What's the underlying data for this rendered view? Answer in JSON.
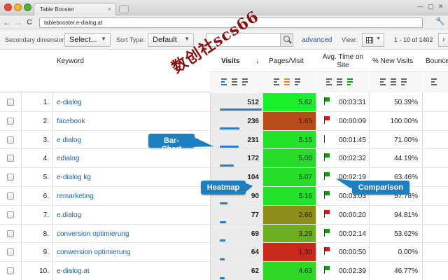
{
  "browser": {
    "tab_title": "Table Booster",
    "tab_close": "×",
    "url": "tablebooster.e-dialog.at",
    "back": "←",
    "forward": "→",
    "reload": "C",
    "wrench": "🔧"
  },
  "controls": {
    "secondary_dimension_label": "Secondary dimension:",
    "secondary_dimension_value": "Select...",
    "sort_type_label": "Sort Type:",
    "sort_type_value": "Default",
    "search_placeholder": "",
    "advanced_label": "advanced",
    "view_label": "View:",
    "pagination": "1 - 10 of 1402",
    "next": "›"
  },
  "table": {
    "headers": {
      "keyword": "Keyword",
      "visits": "Visits",
      "pages_visit": "Pages/Visit",
      "avg_time_line1": "Avg. Time on",
      "avg_time_line2": "Site",
      "new_visits": "% New Visits",
      "bounce": "Bounce"
    },
    "sort_arrow": "↓",
    "rows": [
      {
        "n": "1.",
        "keyword": "e-dialog",
        "visits": "512",
        "pages": "5.62",
        "time": "00:03:31",
        "new": "50.39%",
        "heat": "#17f02a",
        "flag": "#139a13",
        "bar": 1.0
      },
      {
        "n": "2.",
        "keyword": "facebook",
        "visits": "236",
        "pages": "1.65",
        "time": "00:00:09",
        "new": "100.00%",
        "heat": "#b84a18",
        "flag": "#d31818",
        "bar": 0.46
      },
      {
        "n": "3.",
        "keyword": "e dialog",
        "visits": "231",
        "pages": "5.15",
        "time": "00:01:45",
        "new": "71.00%",
        "heat": "#22e229",
        "flag": "#333333",
        "bar": 0.45
      },
      {
        "n": "4.",
        "keyword": "edialog",
        "visits": "172",
        "pages": "5.06",
        "time": "00:02:32",
        "new": "44.19%",
        "heat": "#25dd29",
        "flag": "#139a13",
        "bar": 0.34
      },
      {
        "n": "5.",
        "keyword": "e-dialog kg",
        "visits": "104",
        "pages": "5.07",
        "time": "00:02:19",
        "new": "63.46%",
        "heat": "#25dd29",
        "flag": "#139a13",
        "bar": 0.2
      },
      {
        "n": "6.",
        "keyword": "remarketing",
        "visits": "90",
        "pages": "5.16",
        "time": "00:03:03",
        "new": "57.78%",
        "heat": "#22e229",
        "flag": "#139a13",
        "bar": 0.18
      },
      {
        "n": "7.",
        "keyword": "e.dialog",
        "visits": "77",
        "pages": "2.66",
        "time": "00:00:20",
        "new": "94.81%",
        "heat": "#8f8d1a",
        "flag": "#d31818",
        "bar": 0.15
      },
      {
        "n": "8.",
        "keyword": "conversion optimierung",
        "visits": "69",
        "pages": "3.29",
        "time": "00:02:14",
        "new": "53.62%",
        "heat": "#6cae1d",
        "flag": "#139a13",
        "bar": 0.13
      },
      {
        "n": "9.",
        "keyword": "conwersion optimierung",
        "visits": "64",
        "pages": "1.30",
        "time": "00:00:50",
        "new": "0.00%",
        "heat": "#c9281c",
        "flag": "#d31818",
        "bar": 0.12
      },
      {
        "n": "10.",
        "keyword": "e-dialog.at",
        "visits": "62",
        "pages": "4.63",
        "time": "00:02:39",
        "new": "46.77%",
        "heat": "#2ed626",
        "flag": "#139a13",
        "bar": 0.12
      }
    ]
  },
  "callouts": {
    "bar_chart": "Bar-Chart",
    "heatmap": "Heatmap",
    "comparison": "Comparison",
    "color": "#1e7fc0"
  },
  "watermark": "数创社scs66"
}
